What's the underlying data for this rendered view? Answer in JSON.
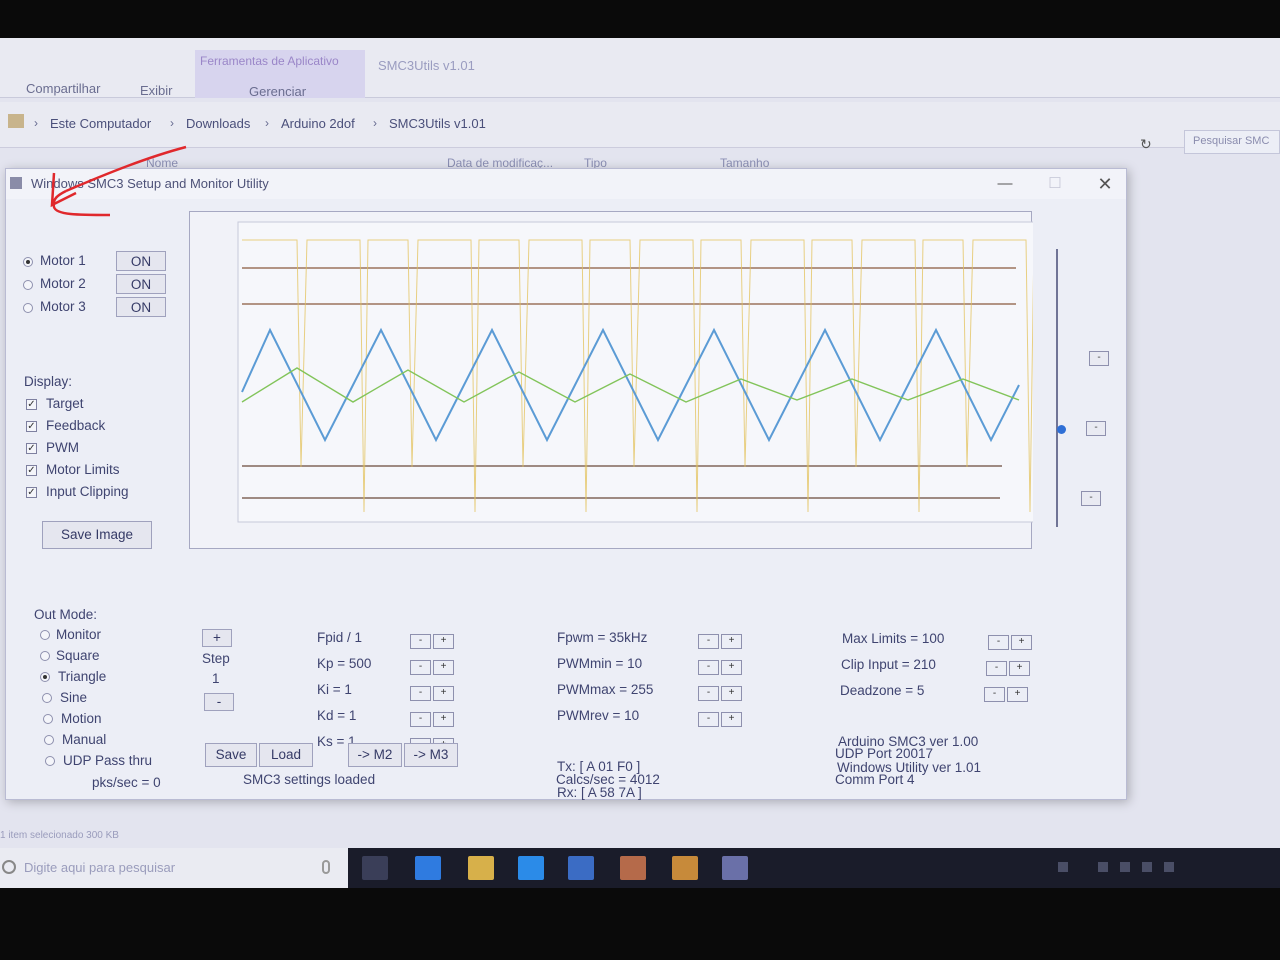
{
  "explorer": {
    "tool_tab": "Ferramentas de Aplicativo",
    "tool_title": "SMC3Utils v1.01",
    "tabs": [
      "Compartilhar",
      "Exibir",
      "Gerenciar"
    ],
    "breadcrumb": [
      "Este Computador",
      "Downloads",
      "Arduino 2dof",
      "SMC3Utils v1.01"
    ],
    "search_placeholder": "Pesquisar SMC",
    "columns": [
      "Nome",
      "Data de modificaç...",
      "Tipo",
      "Tamanho"
    ],
    "status": "1 item selecionado 300 KB"
  },
  "taskbar": {
    "search_placeholder": "Digite aqui para pesquisar",
    "apps": [
      "task-view",
      "edge",
      "explorer",
      "ie",
      "word",
      "media",
      "store",
      "smc3"
    ]
  },
  "window": {
    "title": "Windows SMC3 Setup and Monitor Utility",
    "close_glyph": "✕",
    "minimize_glyph": "—",
    "maximize_glyph": "☐"
  },
  "motors": [
    {
      "label": "Motor 1",
      "button": "ON",
      "selected": true
    },
    {
      "label": "Motor 2",
      "button": "ON",
      "selected": false
    },
    {
      "label": "Motor 3",
      "button": "ON",
      "selected": false
    }
  ],
  "display": {
    "heading": "Display:",
    "check_glyph": "✓",
    "items": [
      "Target",
      "Feedback",
      "PWM",
      "Motor Limits",
      "Input Clipping"
    ],
    "save_image": "Save Image"
  },
  "out_mode": {
    "heading": "Out Mode:",
    "options": [
      "Monitor",
      "Square",
      "Triangle",
      "Sine",
      "Motion",
      "Manual",
      "UDP Pass thru"
    ],
    "selected": "Triangle",
    "pks": "pks/sec = 0"
  },
  "step": {
    "plus": "+",
    "label": "Step",
    "value": "1",
    "minus": "-"
  },
  "pid": [
    "Fpid / 1",
    "Kp = 500",
    "Ki = 1",
    "Kd = 1",
    "Ks = 1"
  ],
  "pwm": [
    "Fpwm = 35kHz",
    "PWMmin = 10",
    "PWMmax = 255",
    "PWMrev = 10"
  ],
  "limits": [
    "Max Limits = 100",
    "Clip Input = 210",
    "Deadzone = 5"
  ],
  "pm_glyphs": {
    "minus": "-",
    "plus": "+"
  },
  "comm": {
    "tx": "Tx: [ A 01 F0 ]",
    "rx": "Rx: [ A 58 7A ]",
    "calcs": "Calcs/sec = 4012"
  },
  "version": [
    "Arduino SMC3 ver 1.00",
    "Windows Utility ver 1.01",
    "UDP Port 20017",
    "Comm Port 4"
  ],
  "bottom_buttons": {
    "save": "Save",
    "load": "Load",
    "m2": "-> M2",
    "m3": "-> M3"
  },
  "status_msg": "SMC3 settings loaded",
  "colors": {
    "target": "#5b9bd5",
    "feedback": "#82c45a",
    "pwm": "#e3c15a",
    "limits": "#8a5a3c",
    "clip": "#6a4a3a"
  }
}
